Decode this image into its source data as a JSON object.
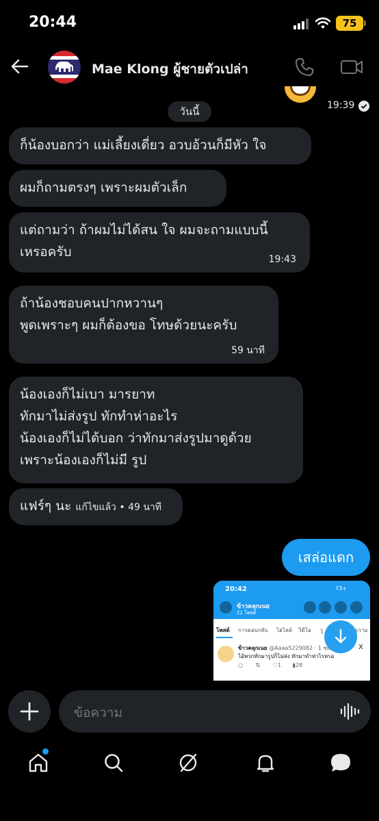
{
  "status_bar": {
    "time": "20:44",
    "battery": "75"
  },
  "header": {
    "contact_name": "Mae Klong ผู้ชายตัวเปล่า"
  },
  "thread": {
    "top_timestamp": "19:39",
    "date_divider": "วันนี้",
    "messages": [
      {
        "lines": [
          "ก็น้องบอกว่า แม่เลี้ยงเดี่ยว อวบอ้วนก็มีหัว ใจ"
        ],
        "time": ""
      },
      {
        "lines": [
          "ผมก็ถามตรงๆ เพราะผมตัวเล็ก"
        ],
        "time": ""
      },
      {
        "lines": [
          "แต่ถามว่า ถ้าผมไม่ได้สน ใจ ผมจะถามแบบนี้",
          "เหรอครับ"
        ],
        "time": "19:43"
      },
      {
        "lines": [
          "ถ้าน้องชอบคนปากหวานๆ",
          "พูดเพราะๆ ผมก็ต้องขอ โทษด้วยนะครับ"
        ],
        "time": "59 นาที"
      },
      {
        "lines": [
          "น้องเองก็ไม่เบา มารยาท",
          "ทักมาไม่ส่งรูป ทักทำห่าอะไร",
          "น้องเองก็ไม่ได้บอก ว่าทักมาส่งรูปมาดูด้วย",
          "เพราะน้องเองก็ไม่มี รูป"
        ],
        "time": ""
      },
      {
        "lines": [
          "แฟร์ๆ นะ"
        ],
        "time": "แก้ไขแล้ว • 49 นาที"
      }
    ],
    "sent_message": "เสล่อแดก",
    "shared_screenshot": {
      "time": "20:42",
      "status": "73+",
      "profile_name": "ข้าวคลุกเนย",
      "post_count": "21 โพสต์",
      "tabs": [
        "โพสต์",
        "การตอบกลับ",
        "ไฮไลต์",
        "วิดีโอ",
        "รู",
        "ความ"
      ],
      "post_author": "ข้าวคลุกเนย",
      "post_handle": "@Aaaa5229082 · 1 ชม.",
      "post_text": "ไอ้พวกทักมารูปก็ไม่ส่ง ทักมาทำห่าไรหรอ",
      "post_stats": [
        "1",
        "1",
        "28"
      ]
    }
  },
  "composer": {
    "placeholder": "ข้อความ"
  },
  "colors": {
    "accent": "#1d9bf0",
    "bubble": "#202327",
    "background": "#000000"
  }
}
